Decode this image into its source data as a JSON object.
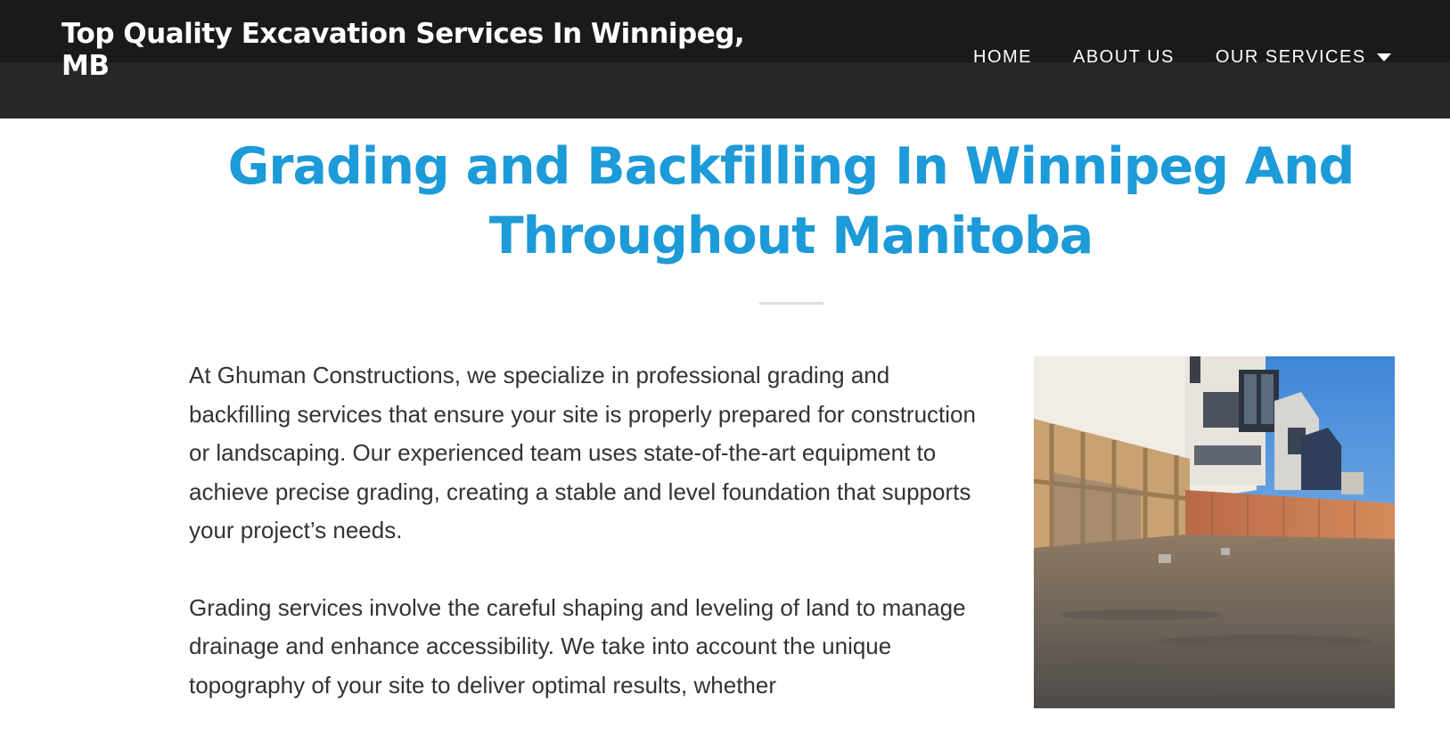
{
  "header": {
    "site_title": "Top Quality Excavation Services In Winnipeg, MB",
    "nav": [
      {
        "label": "HOME"
      },
      {
        "label": "ABOUT US"
      },
      {
        "label": "OUR SERVICES"
      }
    ]
  },
  "main": {
    "heading": "Grading and Backfilling In Winnipeg And Throughout Manitoba",
    "paragraphs": [
      "At Ghuman Constructions, we specialize in professional grading and backfilling services that ensure your site is properly prepared for construction or landscaping. Our experienced team uses state-of-the-art equipment to achieve precise grading, creating a stable and level foundation that supports your project’s needs.",
      "Grading services involve the careful shaping and leveling of land to manage drainage and enhance accessibility. We take into account the unique topography of your site to deliver optimal results, whether"
    ]
  },
  "colors": {
    "heading": "#1d9ad8",
    "header_bg": "#272727",
    "text": "#333333"
  },
  "icons": {
    "dropdown": "caret-down-icon"
  }
}
